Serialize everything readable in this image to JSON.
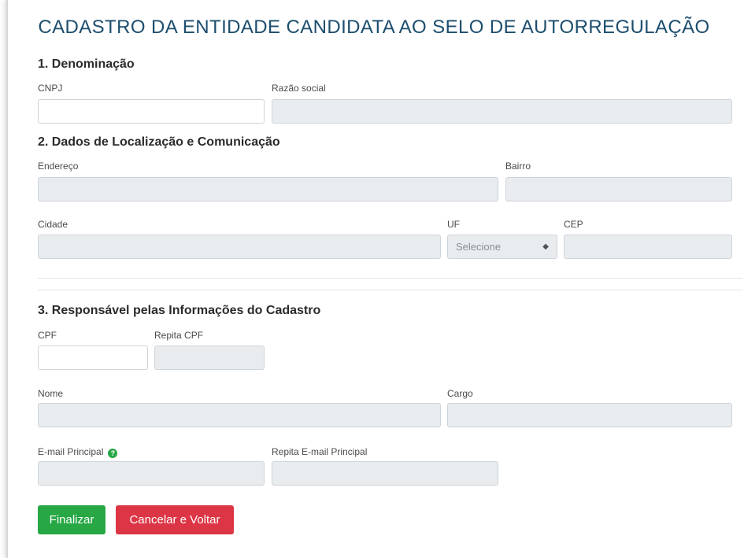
{
  "form": {
    "title": "CADASTRO DA ENTIDADE CANDIDATA AO SELO DE AUTORREGULAÇÃO",
    "section1": {
      "heading": "1. Denominação",
      "cnpj_label": "CNPJ",
      "cnpj_value": "",
      "razao_label": "Razão social",
      "razao_value": ""
    },
    "section2": {
      "heading": "2. Dados de Localização e Comunicação",
      "endereco_label": "Endereço",
      "bairro_label": "Bairro",
      "cidade_label": "Cidade",
      "uf_label": "UF",
      "uf_selected": "Selecione",
      "cep_label": "CEP"
    },
    "section3": {
      "heading": "3. Responsável pelas Informações do Cadastro",
      "cpf_label": "CPF",
      "repita_cpf_label": "Repita CPF",
      "nome_label": "Nome",
      "cargo_label": "Cargo",
      "email_label": "E-mail Principal",
      "help_glyph": "?",
      "repita_email_label": "Repita E-mail Principal"
    },
    "buttons": {
      "finalizar": "Finalizar",
      "cancelar": "Cancelar e Voltar"
    }
  },
  "colors": {
    "title": "#1d4e6e",
    "success": "#28a745",
    "danger": "#dc3545",
    "disabled_field": "#e9ecef"
  }
}
